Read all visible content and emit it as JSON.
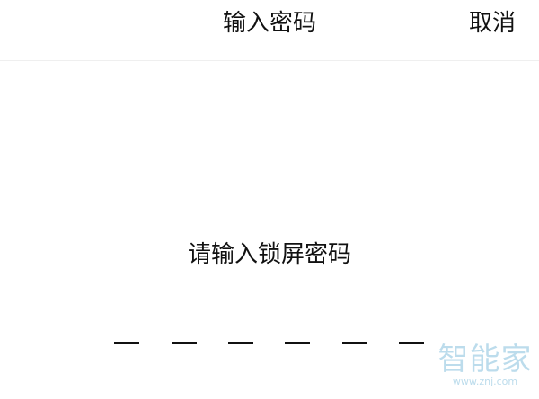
{
  "header": {
    "title": "输入密码",
    "cancel_label": "取消"
  },
  "main": {
    "prompt": "请输入锁屏密码",
    "pin_length": 6
  },
  "watermark": {
    "brand": "智能家",
    "url": "www.znj.com"
  }
}
